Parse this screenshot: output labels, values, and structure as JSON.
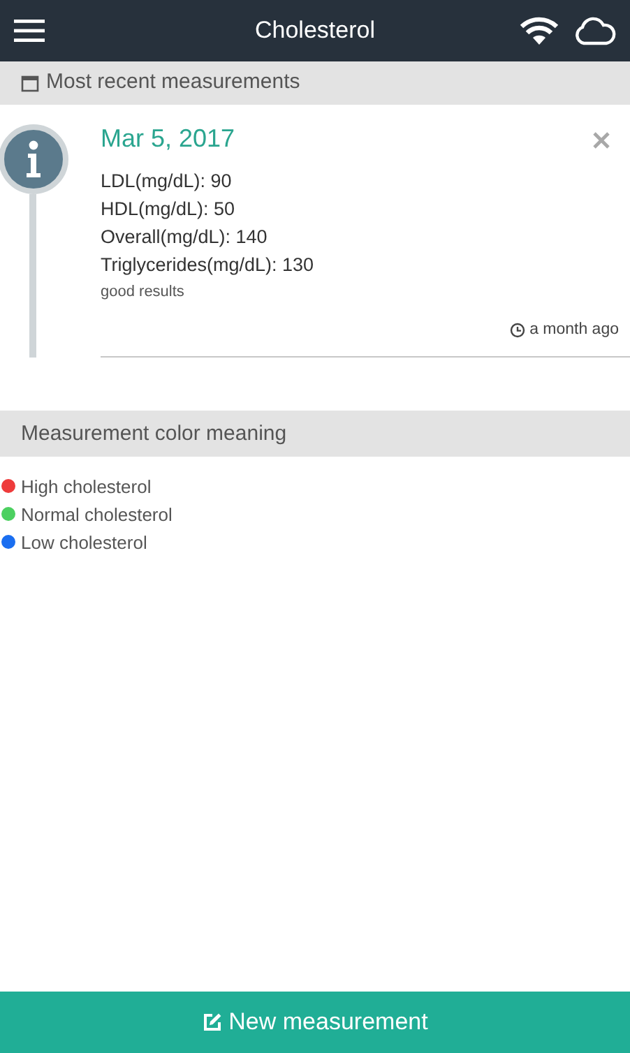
{
  "app_bar": {
    "title": "Cholesterol"
  },
  "recent_section": {
    "title": "Most recent measurements"
  },
  "measurements": [
    {
      "date": "Mar 5, 2017",
      "lines": [
        "LDL(mg/dL): 90",
        "HDL(mg/dL): 50",
        "Overall(mg/dL): 140",
        "Triglycerides(mg/dL): 130"
      ],
      "note": "good results",
      "time": "a month ago"
    }
  ],
  "legend_section": {
    "title": "Measurement color meaning"
  },
  "legend": [
    {
      "label": "High cholesterol",
      "color": "#ee3b3b"
    },
    {
      "label": "Normal cholesterol",
      "color": "#4cd060"
    },
    {
      "label": "Low cholesterol",
      "color": "#1a6ef0"
    }
  ],
  "action_button": {
    "label": "New measurement"
  }
}
